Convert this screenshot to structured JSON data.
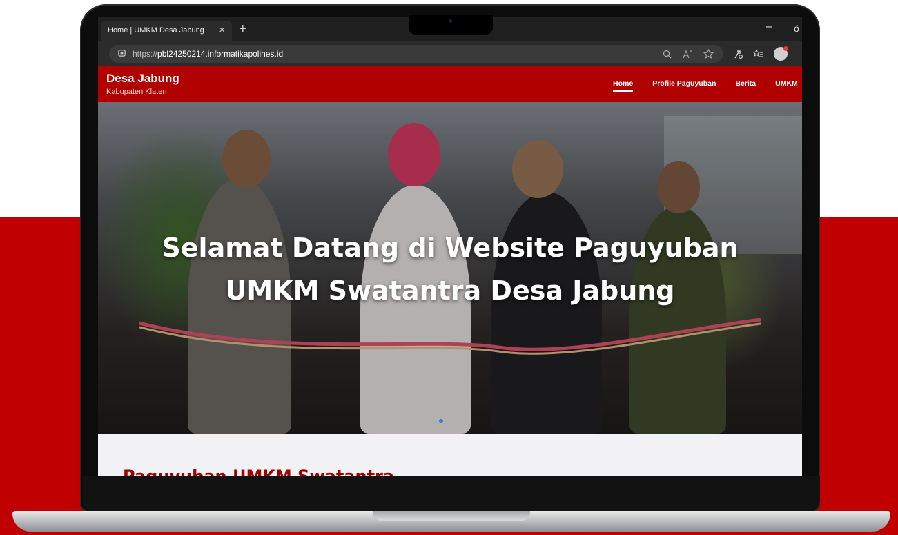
{
  "browser": {
    "tab_title": "Home | UMKM Desa Jabung",
    "tab_close": "×",
    "new_tab": "+",
    "url_prefix": "https://",
    "url_domain": "pbl24250214.informatikapolines.id",
    "window_minimize": "–",
    "window_extra": "ó"
  },
  "site": {
    "brand_title": "Desa Jabung",
    "brand_subtitle": "Kabupaten Klaten",
    "nav": [
      "Home",
      "Profile Paguyuban",
      "Berita",
      "UMKM"
    ],
    "active_nav": "Home",
    "hero_line1": "Selamat Datang di Website Paguyuban",
    "hero_line2": "UMKM Swatantra Desa Jabung",
    "section_heading": "Paguyuban UMKM Swatantra"
  },
  "colors": {
    "brand_red": "#b00000",
    "background_band": "#c00000",
    "carousel_dot": "#3a7bd5"
  }
}
